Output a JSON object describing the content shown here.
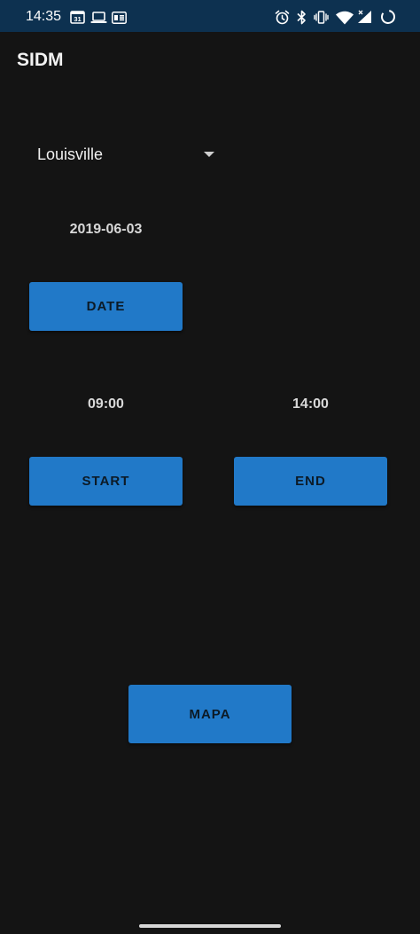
{
  "status_bar": {
    "time": "14:35",
    "calendar_day": "31",
    "background": "#0d3150"
  },
  "app_bar": {
    "title": "SIDM"
  },
  "city_spinner": {
    "selected": "Louisville"
  },
  "date": {
    "value": "2019-06-03",
    "button_label": "DATE"
  },
  "start": {
    "value": "09:00",
    "button_label": "START"
  },
  "end": {
    "value": "14:00",
    "button_label": "END"
  },
  "map": {
    "button_label": "MAPA"
  },
  "colors": {
    "accent": "#2179c8",
    "background": "#141414"
  }
}
